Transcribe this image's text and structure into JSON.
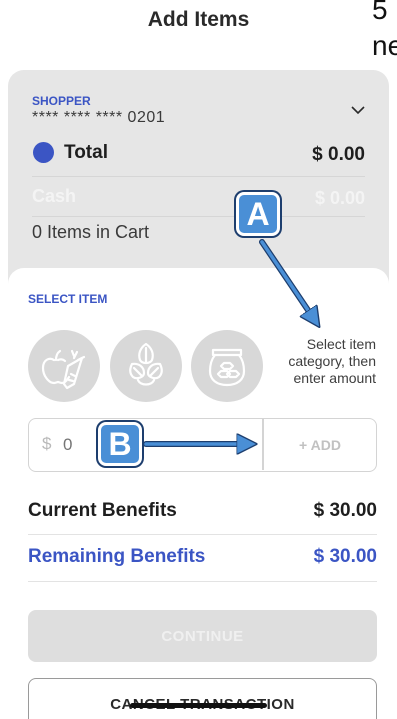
{
  "header": {
    "title": "Add Items"
  },
  "corner_text": [
    "5",
    "ne"
  ],
  "summary": {
    "shopper_label": "SHOPPER",
    "card_number": "**** **** **** 0201",
    "total_label": "Total",
    "total_value": "$ 0.00",
    "cash_label": "Cash",
    "cash_value": "$ 0.00",
    "items_in_cart": "0 Items in Cart"
  },
  "select_item": {
    "label": "SELECT ITEM",
    "categories": [
      "fruits-vegetables-icon",
      "leafy-greens-icon",
      "honey-jar-icon"
    ],
    "hint": "Select item category, then enter amount"
  },
  "amount": {
    "currency": "$",
    "placeholder": "0",
    "add_label": "+ ADD"
  },
  "benefits": {
    "current_label": "Current Benefits",
    "current_value": "$ 30.00",
    "remaining_label": "Remaining Benefits",
    "remaining_value": "$ 30.00"
  },
  "actions": {
    "continue_label": "CONTINUE",
    "cancel_label": "CANCEL TRANSACTION"
  },
  "annotations": {
    "a": "A",
    "b": "B"
  },
  "colors": {
    "accent": "#3b55c4",
    "annotation": "#4a8fd6"
  }
}
